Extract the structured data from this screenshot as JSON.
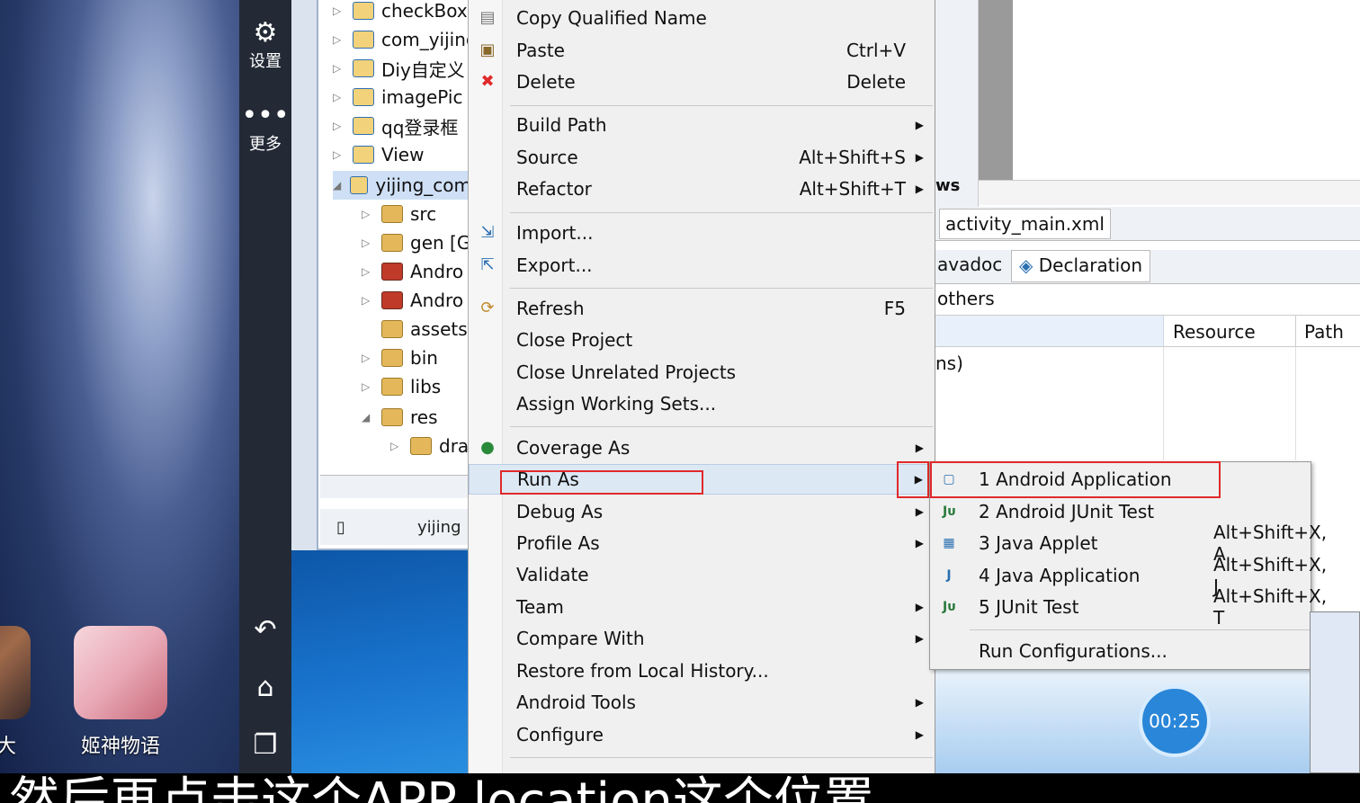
{
  "desktop": {
    "apps": [
      {
        "label": "想大",
        "icon": "game-avatar-icon"
      },
      {
        "label": "姬神物语",
        "icon": "game-avatar-icon"
      }
    ]
  },
  "sidebar": {
    "settings": {
      "icon": "gear-icon",
      "label": "设置"
    },
    "more": {
      "icon": "more-dots-icon",
      "label": "更多"
    },
    "nav": {
      "back_icon": "back-icon",
      "home_icon": "home-icon",
      "recent_icon": "recent-apps-icon"
    }
  },
  "explorer": {
    "items": [
      {
        "label": "checkBox"
      },
      {
        "label": "com_yijing"
      },
      {
        "label": "Diy自定义"
      },
      {
        "label": "imagePic"
      },
      {
        "label": "qq登录框"
      },
      {
        "label": "View"
      },
      {
        "label": "yijing_com"
      },
      {
        "label": "src"
      },
      {
        "label": "gen [G"
      },
      {
        "label": "Andro"
      },
      {
        "label": "Andro"
      },
      {
        "label": "assets"
      },
      {
        "label": "bin"
      },
      {
        "label": "libs"
      },
      {
        "label": "res"
      },
      {
        "label": "dra"
      }
    ],
    "status_text": "yijing"
  },
  "context_menu": {
    "items": [
      {
        "label": "Copy Qualified Name",
        "shortcut": "",
        "icon": "copy-icon"
      },
      {
        "label": "Paste",
        "shortcut": "Ctrl+V",
        "icon": "paste-icon"
      },
      {
        "label": "Delete",
        "shortcut": "Delete",
        "icon": "delete-icon"
      },
      {
        "label": "Build Path",
        "shortcut": "",
        "icon": ""
      },
      {
        "label": "Source",
        "shortcut": "Alt+Shift+S",
        "icon": ""
      },
      {
        "label": "Refactor",
        "shortcut": "Alt+Shift+T",
        "icon": ""
      },
      {
        "label": "Import...",
        "shortcut": "",
        "icon": "import-icon"
      },
      {
        "label": "Export...",
        "shortcut": "",
        "icon": "export-icon"
      },
      {
        "label": "Refresh",
        "shortcut": "F5",
        "icon": "refresh-icon"
      },
      {
        "label": "Close Project",
        "shortcut": "",
        "icon": ""
      },
      {
        "label": "Close Unrelated Projects",
        "shortcut": "",
        "icon": ""
      },
      {
        "label": "Assign Working Sets...",
        "shortcut": "",
        "icon": ""
      },
      {
        "label": "Coverage As",
        "shortcut": "",
        "icon": "coverage-icon"
      },
      {
        "label": "Run As",
        "shortcut": "",
        "icon": ""
      },
      {
        "label": "Debug As",
        "shortcut": "",
        "icon": ""
      },
      {
        "label": "Profile As",
        "shortcut": "",
        "icon": ""
      },
      {
        "label": "Validate",
        "shortcut": "",
        "icon": ""
      },
      {
        "label": "Team",
        "shortcut": "",
        "icon": ""
      },
      {
        "label": "Compare With",
        "shortcut": "",
        "icon": ""
      },
      {
        "label": "Restore from Local History...",
        "shortcut": "",
        "icon": ""
      },
      {
        "label": "Android Tools",
        "shortcut": "",
        "icon": ""
      },
      {
        "label": "Configure",
        "shortcut": "",
        "icon": ""
      }
    ]
  },
  "submenu": {
    "items": [
      {
        "label": "1 Android Application",
        "shortcut": "",
        "icon": "android-app-icon"
      },
      {
        "label": "2 Android JUnit Test",
        "shortcut": "",
        "icon": "junit-icon"
      },
      {
        "label": "3 Java Applet",
        "shortcut": "Alt+Shift+X, A",
        "icon": "applet-icon"
      },
      {
        "label": "4 Java Application",
        "shortcut": "Alt+Shift+X, J",
        "icon": "java-app-icon"
      },
      {
        "label": "5 JUnit Test",
        "shortcut": "Alt+Shift+X, T",
        "icon": "junit-icon"
      },
      {
        "label": "Run Configurations...",
        "shortcut": "",
        "icon": ""
      }
    ]
  },
  "editor": {
    "tab_frag": "ws",
    "file_tab": "activity_main.xml",
    "view_tabs": [
      "avadoc",
      "Declaration"
    ],
    "others": "others",
    "columns": [
      "Resource",
      "Path"
    ],
    "row_frag": "ns)"
  },
  "recorder": {
    "time": "00:25"
  },
  "caption": {
    "text": "然后再点击这个APP location这个位置"
  },
  "colors": {
    "highlight_box": "#e02a2a",
    "accent": "#2a86d8"
  }
}
